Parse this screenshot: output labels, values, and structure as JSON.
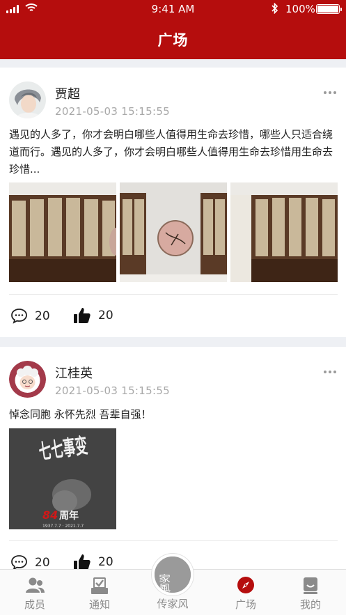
{
  "status_bar": {
    "time": "9:41 AM",
    "battery": "100%"
  },
  "header": {
    "title": "广场"
  },
  "posts": [
    {
      "name": "贾超",
      "date": "2021-05-03   15:15:55",
      "content": "遇见的人多了，你才会明白哪些人值得用生命去珍惜，哪些人只适合绕道而行。遇见的人多了，你才会明白哪些人值得用生命去珍惜用生命去珍惜...",
      "comments": "20",
      "likes": "20"
    },
    {
      "name": "江桂英",
      "date": "2021-05-03   15:15:55",
      "content": "悼念同胞 永怀先烈 吾辈自强！",
      "image_text": {
        "title": "七七事变",
        "years": "84",
        "suffix": "周年",
        "dates": "1937.7.7 · 2021.7.7"
      },
      "comments": "20",
      "likes": "20"
    }
  ],
  "nav": {
    "items": [
      {
        "label": "成员"
      },
      {
        "label": "通知"
      },
      {
        "label": "传家风"
      },
      {
        "label": "广场"
      },
      {
        "label": "我的"
      }
    ],
    "center_logo": "家風"
  },
  "colors": {
    "brand": "#b50d0d",
    "background": "#eef0f4",
    "nav_inactive": "#8a8a8a"
  }
}
